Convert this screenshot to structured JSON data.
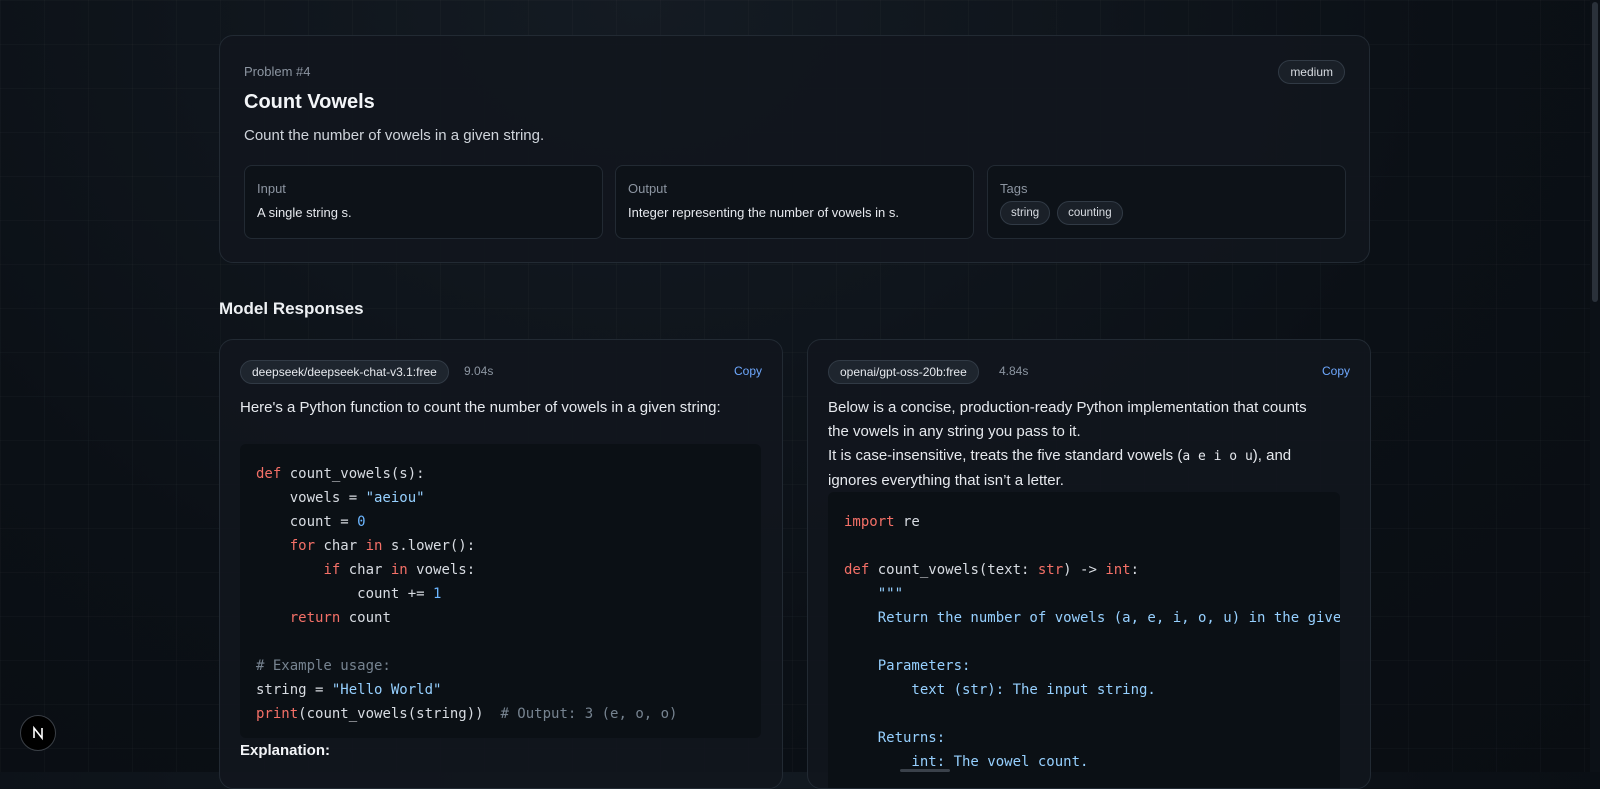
{
  "problem": {
    "number_label": "Problem #4",
    "difficulty": "medium",
    "title": "Count Vowels",
    "description": "Count the number of vowels in a given string.",
    "input": {
      "label": "Input",
      "value": "A single string s."
    },
    "output": {
      "label": "Output",
      "value": "Integer representing the number of vowels in s."
    },
    "tags": {
      "label": "Tags",
      "items": [
        "string",
        "counting"
      ]
    }
  },
  "section_title": "Model Responses",
  "responses": [
    {
      "model": "deepseek/deepseek-chat-v3.1:free",
      "time": "9.04s",
      "copy_label": "Copy",
      "intro": "Here's a Python function to count the number of vowels in a given string:",
      "explanation_heading": "Explanation:"
    },
    {
      "model": "openai/gpt-oss-20b:free",
      "time": "4.84s",
      "copy_label": "Copy",
      "intro_1": "Below is a concise, production-ready Python implementation that counts the vowels in any string you pass to it.",
      "intro_2_pre": "It is case-insensitive, treats the five standard vowels (",
      "intro_2_code": "a e i o u",
      "intro_2_post": "), and ignores everything that isn’t a letter."
    }
  ],
  "icons": {
    "framework_badge": "next-logo-icon"
  }
}
